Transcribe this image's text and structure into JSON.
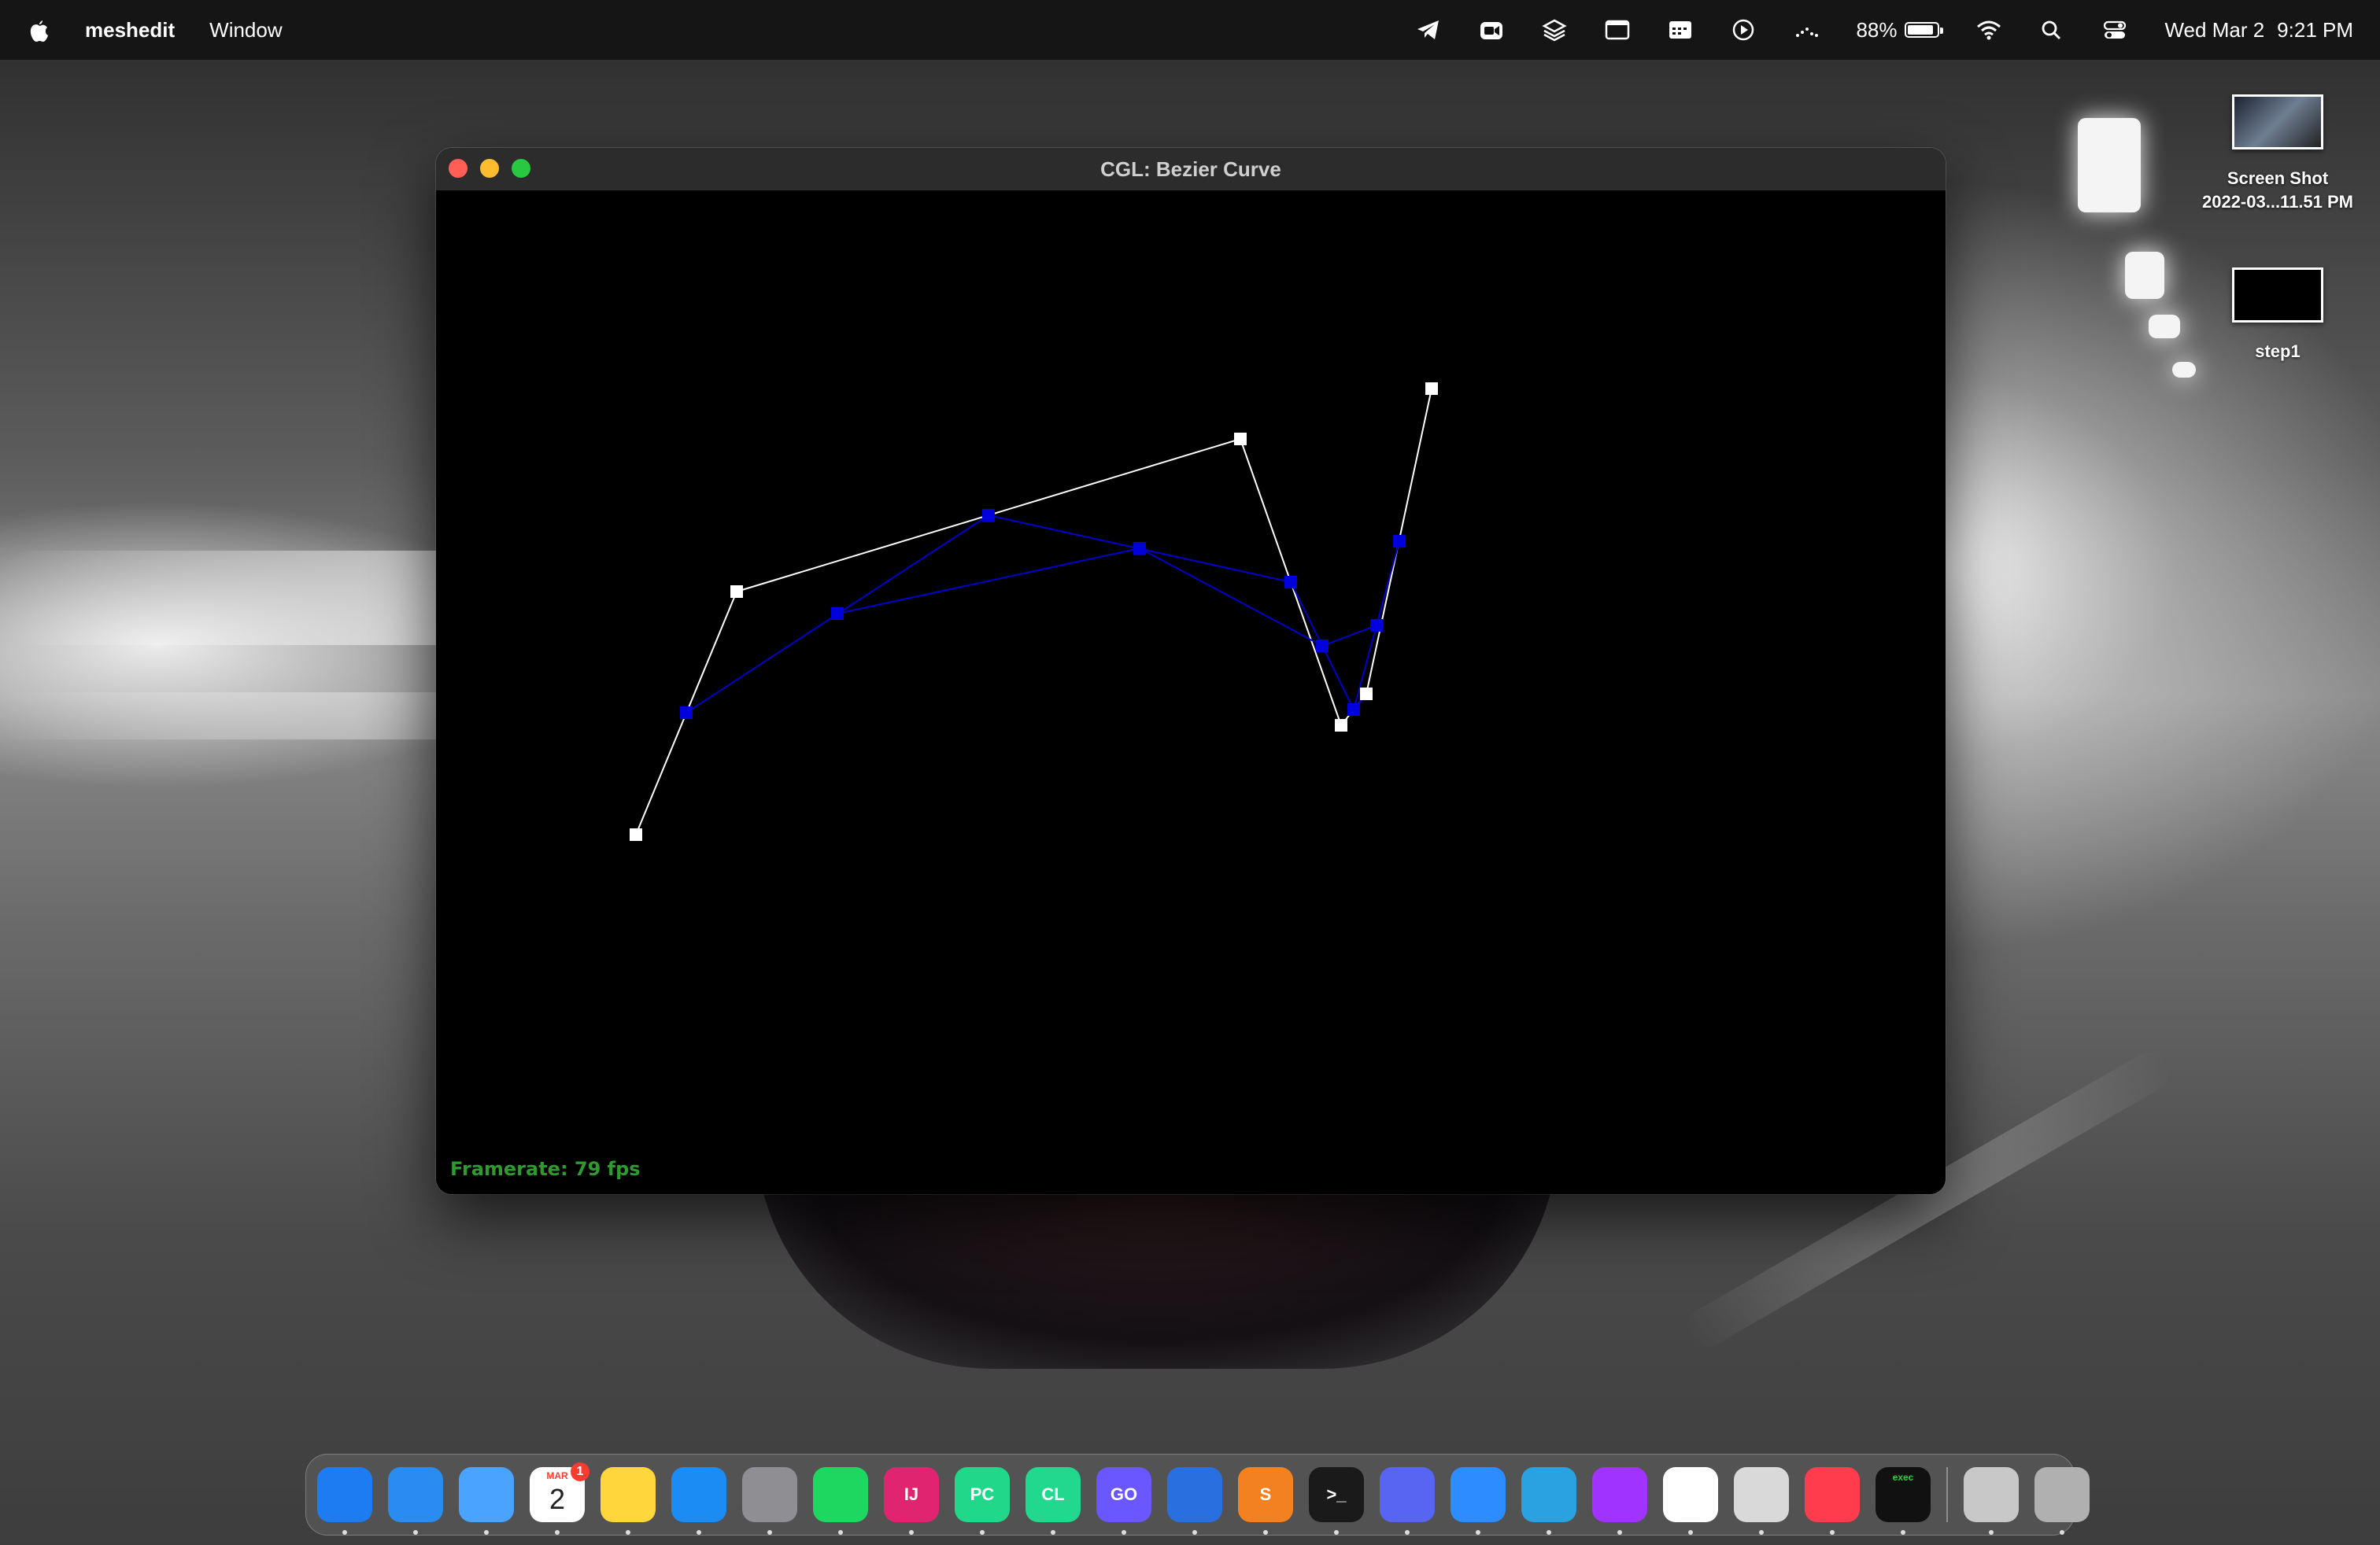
{
  "menubar": {
    "app_name": "meshedit",
    "menus": [
      "Window"
    ],
    "status_icons": [
      "telegram-icon",
      "zoom-icon",
      "layers-icon",
      "screen-icon",
      "calendar-icon",
      "play-icon",
      "dots-icon"
    ],
    "battery_percent": "88%",
    "battery_level": 0.88,
    "date": "Wed Mar 2",
    "time": "9:21 PM"
  },
  "window": {
    "title": "CGL: Bezier Curve",
    "framerate": "Framerate: 79 fps",
    "colors": {
      "control": "#ffffff",
      "intermediate": "#0000cc",
      "background": "#000000",
      "framerate": "#2e9b2e"
    }
  },
  "desktop": {
    "items": [
      {
        "label_line1": "Screen Shot",
        "label_line2": "2022-03...11.51 PM",
        "icon": "screenshot-thumbnail"
      },
      {
        "label_line1": "step1",
        "label_line2": "",
        "icon": "image-thumbnail"
      }
    ]
  },
  "dock": {
    "apps": [
      {
        "name": "Finder",
        "color": "#1e7cf2"
      },
      {
        "name": "Safari",
        "color": "#2a8cf0"
      },
      {
        "name": "Mail",
        "color": "#4aa3ff"
      },
      {
        "name": "Calendar",
        "color": "#ffffff",
        "month": "MAR",
        "day": "2",
        "badge": "1"
      },
      {
        "name": "Notes",
        "color": "#ffd63c"
      },
      {
        "name": "App Store",
        "color": "#1c8cf5"
      },
      {
        "name": "System Preferences",
        "color": "#8e8e93"
      },
      {
        "name": "Spotify",
        "color": "#1ed760"
      },
      {
        "name": "IntelliJ IDEA",
        "color": "#e0246f",
        "text": "IJ"
      },
      {
        "name": "PyCharm",
        "color": "#21d789",
        "text": "PC"
      },
      {
        "name": "CLion",
        "color": "#22d88f",
        "text": "CL"
      },
      {
        "name": "GoLand",
        "color": "#6b57ff",
        "text": "GO"
      },
      {
        "name": "Xcode",
        "color": "#2a6fe0"
      },
      {
        "name": "Sublime Text",
        "color": "#f48120",
        "text": "S"
      },
      {
        "name": "Terminal",
        "color": "#1a1a1a",
        "text": ">_"
      },
      {
        "name": "Discord",
        "color": "#5865f2"
      },
      {
        "name": "Zoom",
        "color": "#2d8cff"
      },
      {
        "name": "Telegram",
        "color": "#2aa1e0"
      },
      {
        "name": "Messenger",
        "color": "#a033ff"
      },
      {
        "name": "Slack",
        "color": "#ffffff"
      },
      {
        "name": "Preview",
        "color": "#d9d9d9"
      },
      {
        "name": "News",
        "color": "#ff3b4e"
      },
      {
        "name": "meshedit",
        "color": "#111111",
        "text": "exec"
      },
      {
        "name": "Downloads",
        "color": "#c8c8c8"
      },
      {
        "name": "Trash",
        "color": "#b0b0b0"
      }
    ]
  }
}
